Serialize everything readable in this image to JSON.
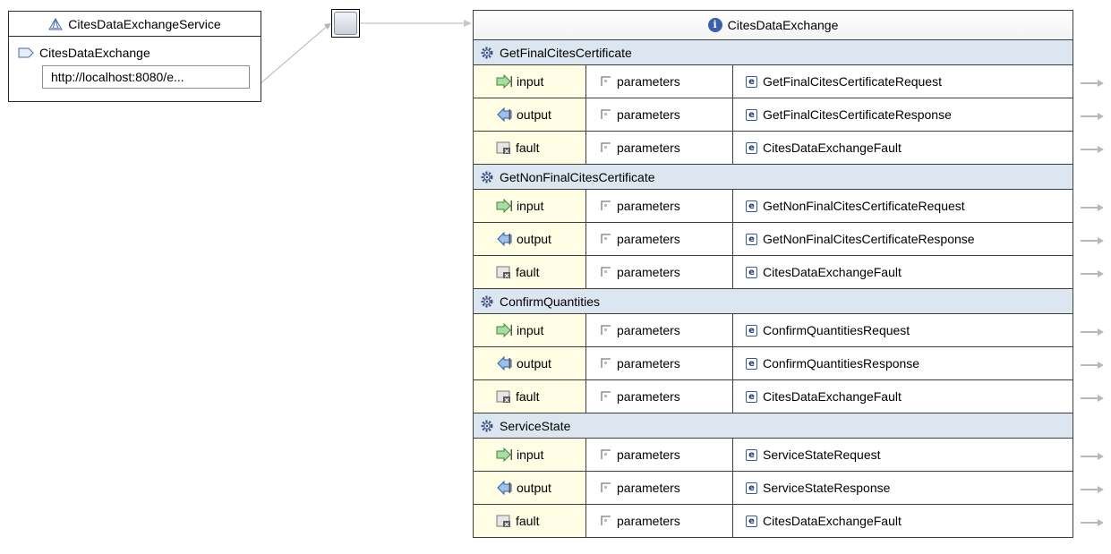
{
  "service": {
    "name": "CitesDataExchangeService",
    "port_name": "CitesDataExchange",
    "address": "http://localhost:8080/e..."
  },
  "port_type": {
    "name": "CitesDataExchange",
    "operations": [
      {
        "name": "GetFinalCitesCertificate",
        "messages": [
          {
            "kind": "input",
            "part": "parameters",
            "element": "GetFinalCitesCertificateRequest"
          },
          {
            "kind": "output",
            "part": "parameters",
            "element": "GetFinalCitesCertificateResponse"
          },
          {
            "kind": "fault",
            "part": "parameters",
            "element": "CitesDataExchangeFault"
          }
        ]
      },
      {
        "name": "GetNonFinalCitesCertificate",
        "messages": [
          {
            "kind": "input",
            "part": "parameters",
            "element": "GetNonFinalCitesCertificateRequest"
          },
          {
            "kind": "output",
            "part": "parameters",
            "element": "GetNonFinalCitesCertificateResponse"
          },
          {
            "kind": "fault",
            "part": "parameters",
            "element": "CitesDataExchangeFault"
          }
        ]
      },
      {
        "name": "ConfirmQuantities",
        "messages": [
          {
            "kind": "input",
            "part": "parameters",
            "element": "ConfirmQuantitiesRequest"
          },
          {
            "kind": "output",
            "part": "parameters",
            "element": "ConfirmQuantitiesResponse"
          },
          {
            "kind": "fault",
            "part": "parameters",
            "element": "CitesDataExchangeFault"
          }
        ]
      },
      {
        "name": "ServiceState",
        "messages": [
          {
            "kind": "input",
            "part": "parameters",
            "element": "ServiceStateRequest"
          },
          {
            "kind": "output",
            "part": "parameters",
            "element": "ServiceStateResponse"
          },
          {
            "kind": "fault",
            "part": "parameters",
            "element": "CitesDataExchangeFault"
          }
        ]
      }
    ]
  },
  "icons": {
    "service": "service-icon",
    "port": "port-icon",
    "binding": "binding-icon",
    "interface": "interface-icon",
    "operation": "operation-gear-icon",
    "input": "input-arrow-icon",
    "output": "output-arrow-icon",
    "fault": "fault-icon",
    "part": "part-icon",
    "element": "element-icon",
    "navigate": "navigate-arrow-icon"
  },
  "colors": {
    "operation_row": "#dce6f1",
    "message_kind_cell": "#fffde3",
    "border": "#3f3f3f",
    "connector": "#b4b4b4"
  }
}
